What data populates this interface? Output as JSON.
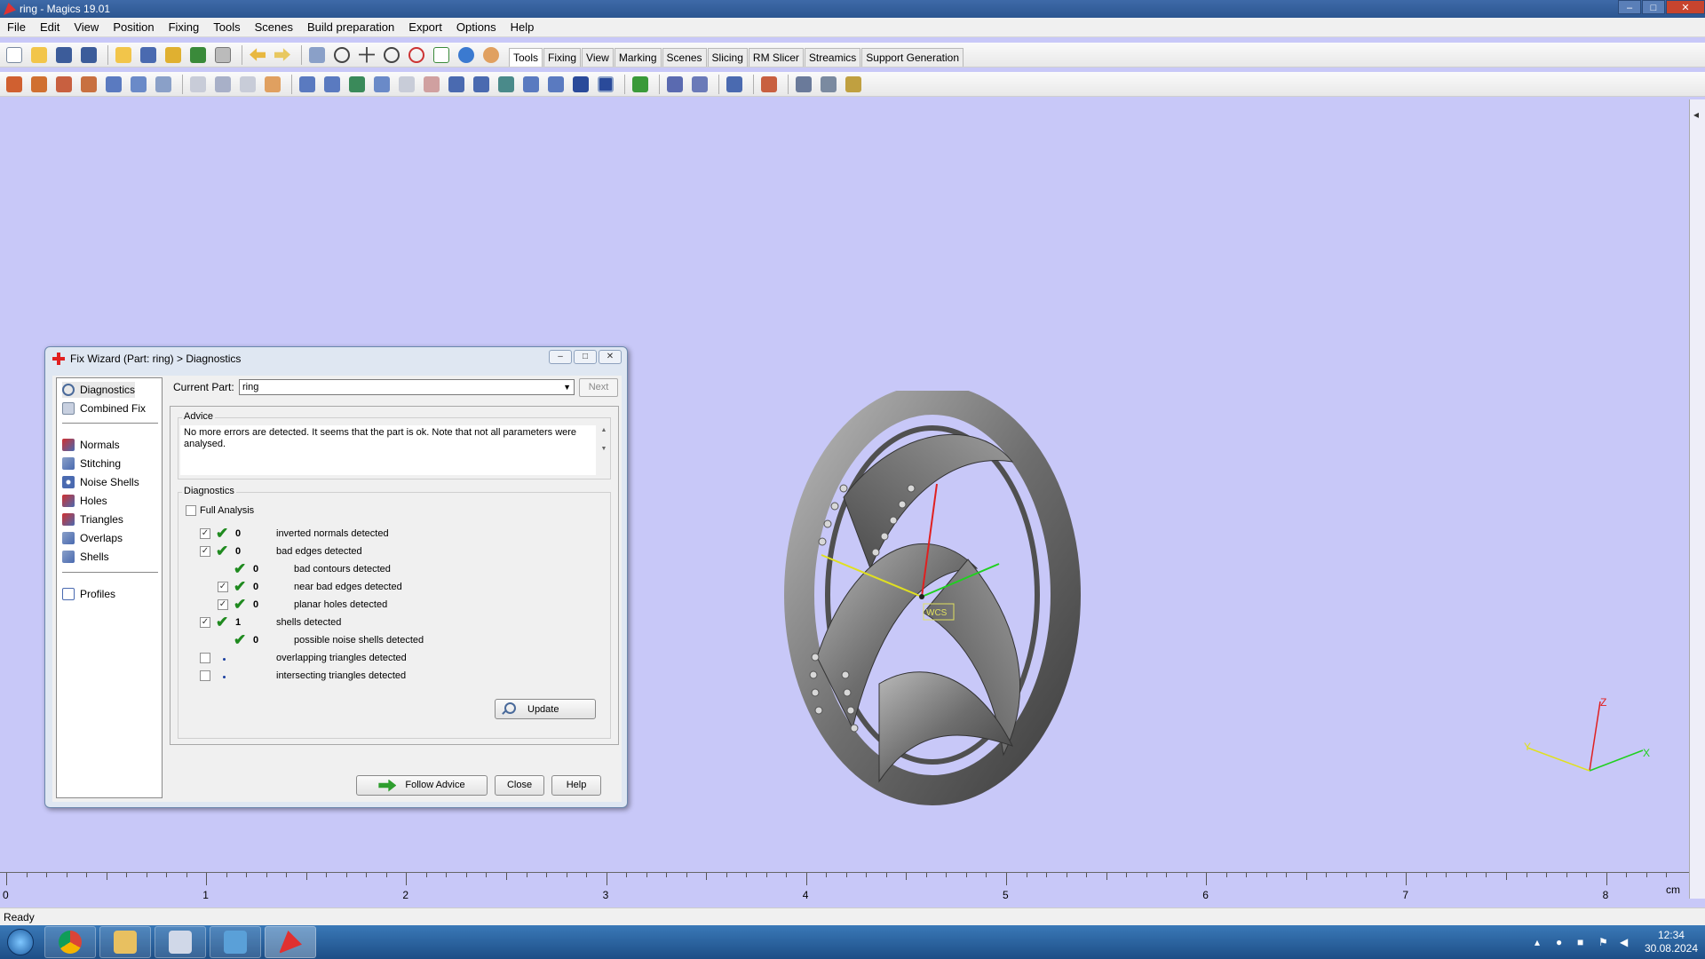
{
  "window": {
    "title": "ring - Magics 19.01",
    "controls": [
      "–",
      "□",
      "✕"
    ]
  },
  "menu": [
    "File",
    "Edit",
    "View",
    "Position",
    "Fixing",
    "Tools",
    "Scenes",
    "Build preparation",
    "Export",
    "Options",
    "Help"
  ],
  "ribbon_tabs": [
    "Tools",
    "Fixing",
    "View",
    "Marking",
    "Scenes",
    "Slicing",
    "RM Slicer",
    "Streamics",
    "Support Generation"
  ],
  "dialog": {
    "title": "Fix Wizard (Part: ring) > Diagnostics",
    "nav": {
      "top": [
        "Diagnostics",
        "Combined Fix"
      ],
      "middle": [
        "Normals",
        "Stitching",
        "Noise Shells",
        "Holes",
        "Triangles",
        "Overlaps",
        "Shells"
      ],
      "bottom": [
        "Profiles"
      ]
    },
    "current_part_label": "Current Part:",
    "current_part_value": "ring",
    "next_label": "Next",
    "advice_title": "Advice",
    "advice_text": "No more errors are detected. It seems that the part is ok. Note that not all parameters were analysed.",
    "diagnostics_title": "Diagnostics",
    "full_analysis_label": "Full Analysis",
    "rows": [
      {
        "checked": true,
        "status": "ok",
        "count": "0",
        "label": "inverted normals detected"
      },
      {
        "checked": true,
        "status": "ok",
        "count": "0",
        "label": "bad edges detected"
      },
      {
        "checked": null,
        "status": "ok",
        "count": "0",
        "label": "bad contours detected"
      },
      {
        "checked": true,
        "status": "ok",
        "count": "0",
        "label": "near bad edges detected"
      },
      {
        "checked": true,
        "status": "ok",
        "count": "0",
        "label": "planar holes detected"
      },
      {
        "checked": true,
        "status": "ok",
        "count": "1",
        "label": "shells detected"
      },
      {
        "checked": null,
        "status": "ok",
        "count": "0",
        "label": "possible noise shells detected"
      },
      {
        "checked": false,
        "status": "none",
        "count": "",
        "label": "overlapping triangles detected"
      },
      {
        "checked": false,
        "status": "none",
        "count": "",
        "label": "intersecting triangles detected"
      }
    ],
    "update_label": "Update",
    "follow_advice_label": "Follow Advice",
    "close_label": "Close",
    "help_label": "Help"
  },
  "viewport": {
    "wcs_label": "WCS",
    "axis_labels": {
      "x": "X",
      "y": "Y",
      "z": "Z"
    }
  },
  "ruler": {
    "labels": [
      "0",
      "1",
      "2",
      "3",
      "4",
      "5",
      "6",
      "7",
      "8"
    ],
    "unit": "cm"
  },
  "status": "Ready",
  "taskbar": {
    "time": "12:34",
    "date": "30.08.2024"
  },
  "colors": {
    "viewport_bg": "#c8c8f8",
    "check_green": "#1f8a1f",
    "ring_gray": "#7a7a7a"
  }
}
